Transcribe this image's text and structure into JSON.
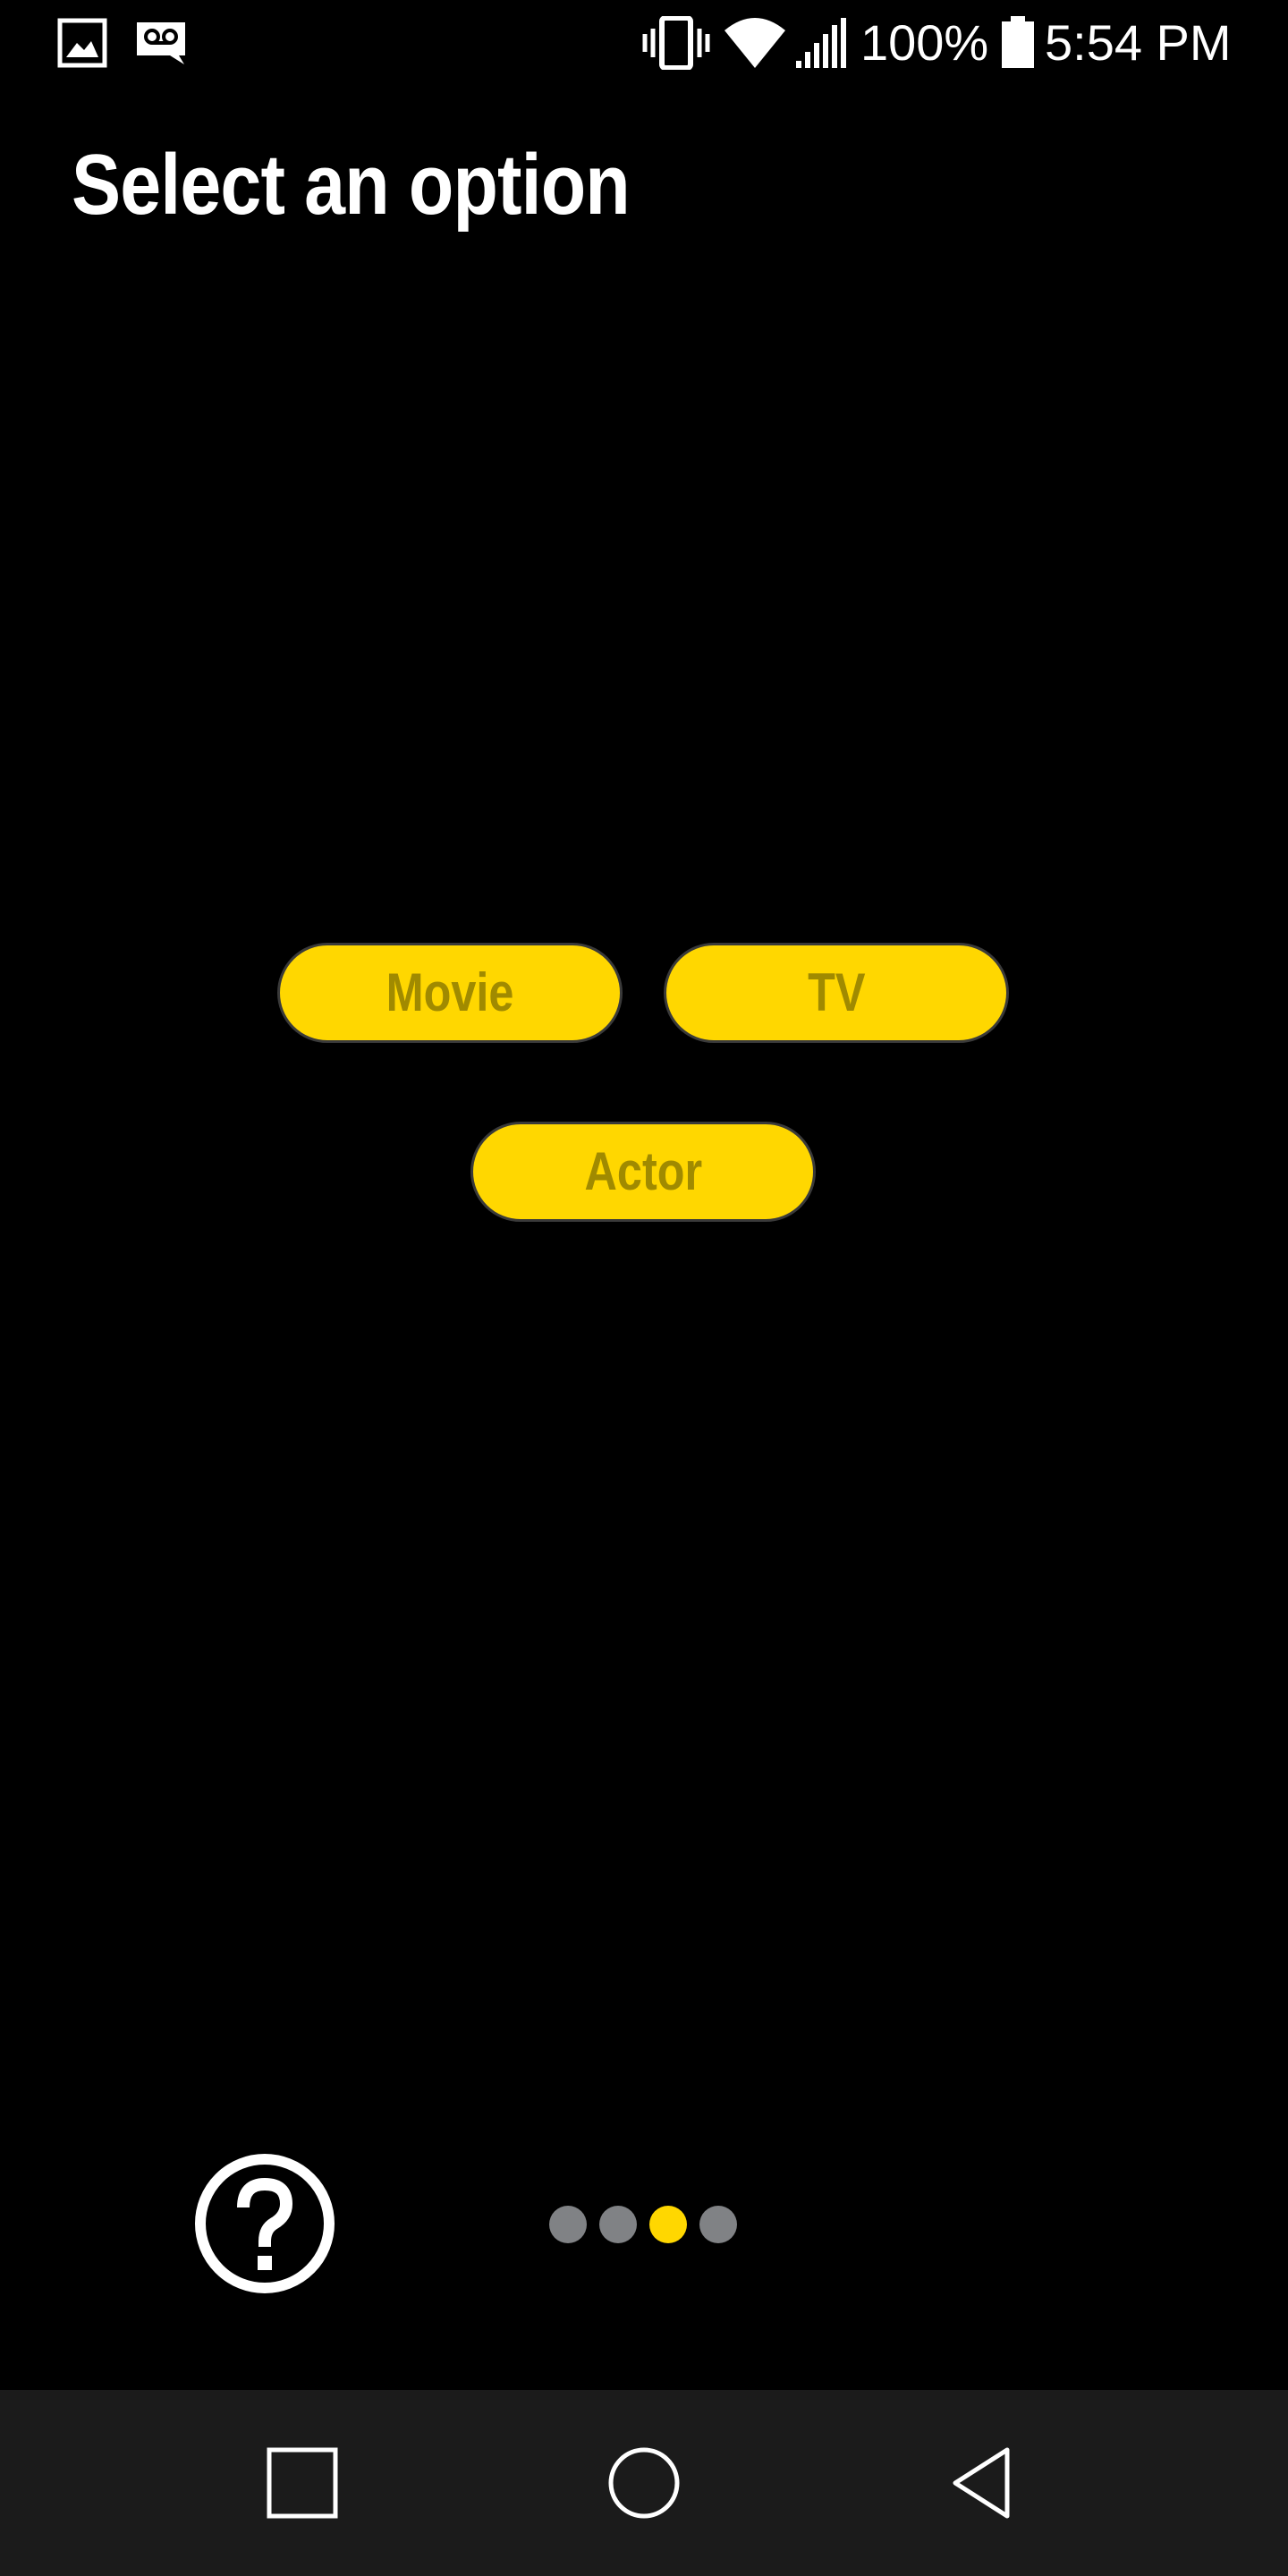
{
  "status_bar": {
    "battery_percent": "100%",
    "time": "5:54 PM",
    "icons": [
      "image-notification-icon",
      "voicemail-icon",
      "vibrate-icon",
      "wifi-icon",
      "cell-signal-icon",
      "battery-icon"
    ]
  },
  "page": {
    "title": "Select an option"
  },
  "options": {
    "movie_label": "Movie",
    "tv_label": "TV",
    "actor_label": "Actor"
  },
  "pager": {
    "total_pages": 4,
    "current_page": 3
  },
  "help": {
    "icon": "help-circle-icon"
  },
  "nav_bar": {
    "icons": [
      "recents-icon",
      "home-icon",
      "back-icon"
    ]
  },
  "colors": {
    "background": "#000000",
    "accent": "#FFD700",
    "button_text": "#A08A00",
    "dot_inactive": "#808285",
    "nav_bar": "#1b1b1b"
  }
}
